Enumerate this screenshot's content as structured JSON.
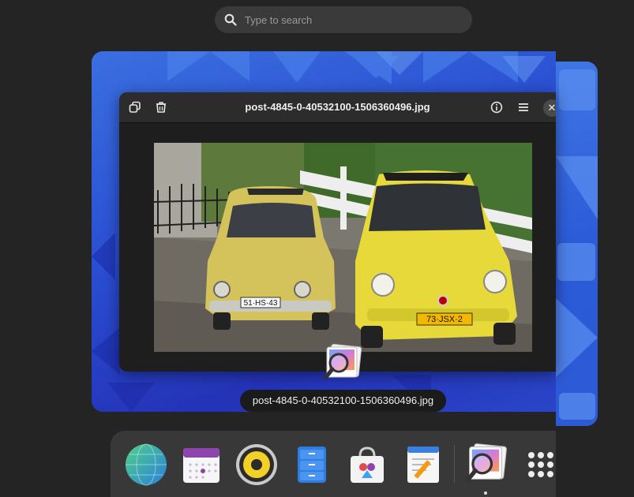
{
  "search": {
    "placeholder": "Type to search"
  },
  "window": {
    "title": "post-4845-0-40532100-1506360496.jpg"
  },
  "tooltip": {
    "text": "post-4845-0-40532100-1506360496.jpg"
  },
  "photo": {
    "left_plate": "51·HS·43",
    "right_plate": "73·JSX·2"
  },
  "colors": {
    "background": "#242424",
    "wallpaper": "#2a4fd2",
    "window_bg": "#1e1e1e",
    "dock": "#383838"
  },
  "dock": {
    "items": [
      {
        "icon": "web-browser-icon"
      },
      {
        "icon": "calendar-icon"
      },
      {
        "icon": "speaker-icon"
      },
      {
        "icon": "file-cabinet-icon"
      },
      {
        "icon": "software-store-icon"
      },
      {
        "icon": "text-editor-icon"
      },
      {
        "icon": "image-viewer-icon",
        "running": true
      },
      {
        "icon": "show-apps-icon"
      }
    ]
  }
}
